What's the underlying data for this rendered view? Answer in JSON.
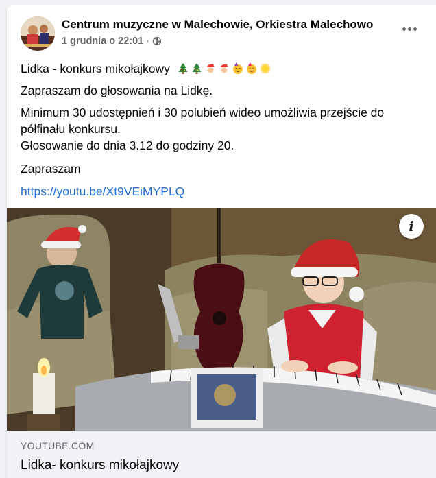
{
  "post": {
    "author": "Centrum muzyczne w Malechowie, Orkiestra Malechowo",
    "timestamp": "1 grudnia o 22:01",
    "separator": "·",
    "privacy_icon": "globe-icon",
    "more_icon": "more-horizontal-icon",
    "title_line": "Lidka - konkurs mikołajkowy",
    "title_emojis": [
      "christmas-tree",
      "christmas-tree",
      "santa-face",
      "santa-face",
      "party-face",
      "party-face",
      "sun"
    ],
    "paragraph_2": "Zapraszam do głosowania na Lidkę.",
    "paragraph_3_line_1": "Minimum 30 udostępnień i 30 polubień wideo umożliwia przejście do",
    "paragraph_3_line_2": "półfinału konkursu.",
    "paragraph_3_line_3": "Głosowanie do dnia 3.12 do godziny 20.",
    "paragraph_4": "Zapraszam",
    "link": "https://youtu.be/Xt9VEiMYPLQ"
  },
  "link_preview": {
    "domain": "YOUTUBE.COM",
    "title": "Lidka- konkurs mikołajkowy",
    "info_icon": "info-icon"
  },
  "colors": {
    "link": "#216fdb",
    "secondary_text": "#65676b",
    "background": "#f0f2f5"
  }
}
